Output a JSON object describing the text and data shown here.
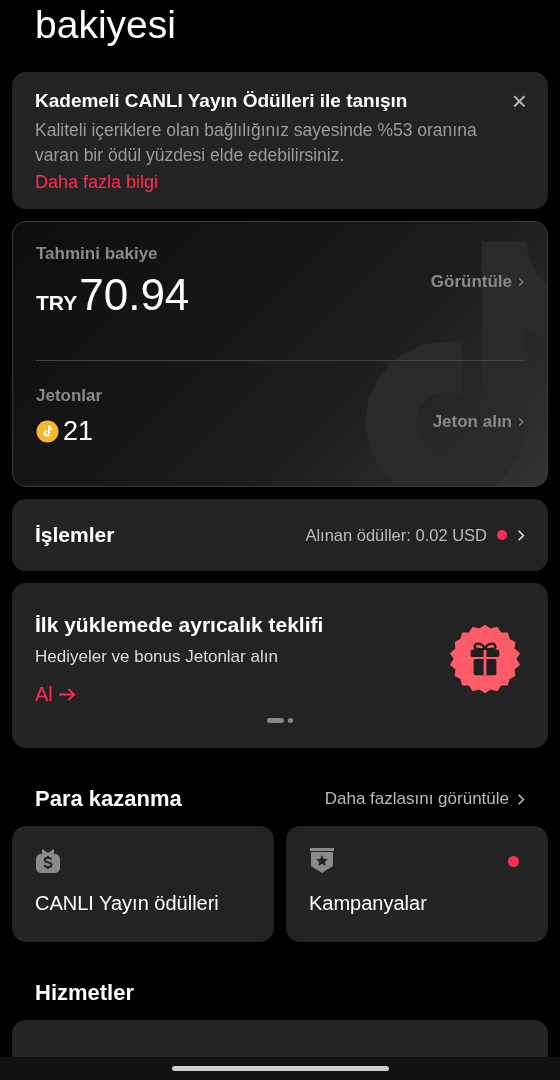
{
  "page_title": "bakiyesi",
  "notice": {
    "title": "Kademeli CANLI Yayın Ödülleri ile tanışın",
    "body": "Kaliteli içeriklere olan bağlılığınız sayesinde %53 oranına varan bir ödül yüzdesi elde edebilirsiniz.",
    "link": "Daha fazla bilgi",
    "close": "×"
  },
  "balance": {
    "label": "Tahmini bakiye",
    "currency": "TRY",
    "amount": "70.94",
    "action": "Görüntüle"
  },
  "coins": {
    "label": "Jetonlar",
    "count": "21",
    "action": "Jeton alın"
  },
  "transactions": {
    "label": "İşlemler",
    "detail": "Alınan ödüller: 0.02 USD",
    "unread": true
  },
  "offer": {
    "title": "İlk yüklemede ayrıcalık teklifi",
    "subtitle": "Hediyeler ve bonus Jetonlar alın",
    "action": "Al",
    "pager": [
      {
        "selected": true
      },
      {
        "selected": false
      }
    ]
  },
  "monetization": {
    "heading": "Para kazanma",
    "more": "Daha fazlasını görüntüle",
    "tiles": [
      {
        "kind": "money",
        "label": "CANLI Yayın ödülleri",
        "unread": false
      },
      {
        "kind": "badge",
        "label": "Kampanyalar",
        "unread": true
      }
    ]
  },
  "services": {
    "heading": "Hizmetler"
  }
}
